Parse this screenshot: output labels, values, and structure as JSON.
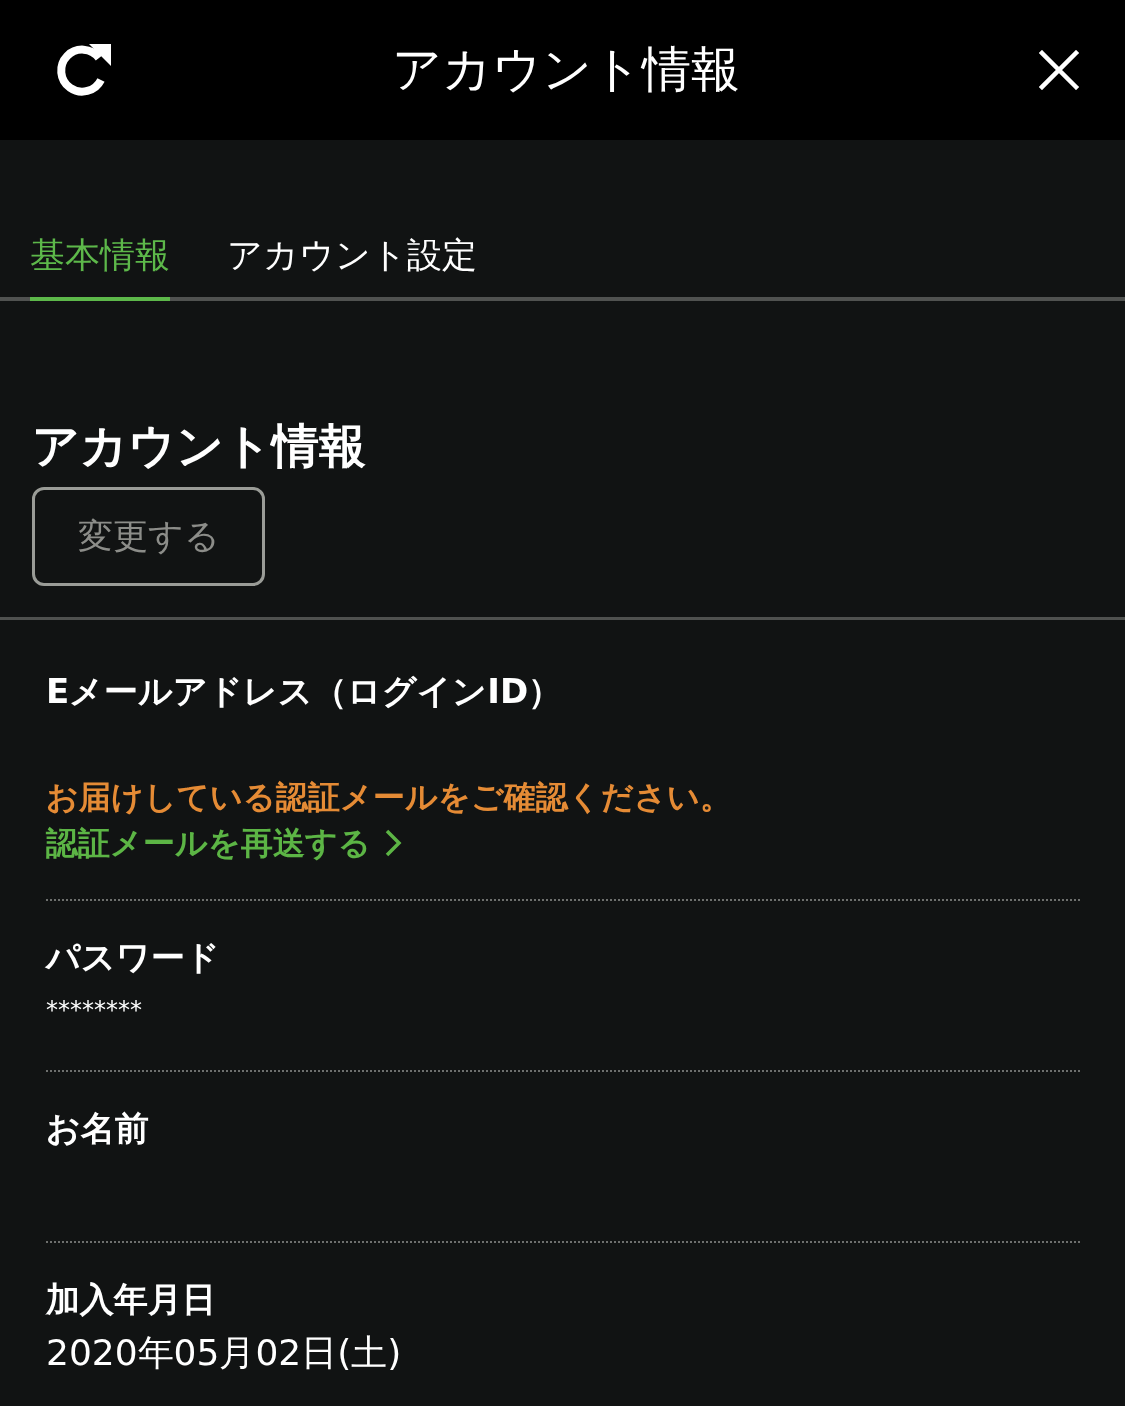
{
  "header": {
    "title": "アカウント情報"
  },
  "tabs": [
    {
      "label": "基本情報",
      "selected": true
    },
    {
      "label": "アカウント設定",
      "selected": false
    }
  ],
  "section": {
    "title": "アカウント情報",
    "button": "変更する"
  },
  "fields": [
    {
      "kind": "verification",
      "label": "Eメールアドレス（ログインID）",
      "notice": "お届けしている認証メールをご確認ください。",
      "link": "認証メールを再送する"
    },
    {
      "kind": "masked",
      "label": "パスワード",
      "value": "********"
    },
    {
      "kind": "text",
      "label": "お名前"
    },
    {
      "kind": "text",
      "label": "加入年月日",
      "value": "2020年05月02日(土)"
    }
  ]
}
